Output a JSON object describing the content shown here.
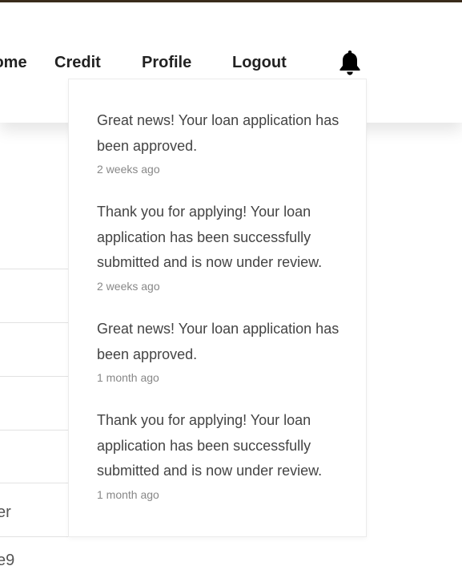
{
  "nav": {
    "items": [
      {
        "label": "Home"
      },
      {
        "label": "Credit"
      },
      {
        "label": "Profile"
      },
      {
        "label": "Logout"
      }
    ],
    "bell_icon": "bell-icon"
  },
  "notifications": [
    {
      "message": "Great news! Your loan application has been approved.",
      "time": "2 weeks ago"
    },
    {
      "message": "Thank you for applying! Your loan application has been successfully submitted and is now under review.",
      "time": "2 weeks ago"
    },
    {
      "message": "Great news! Your loan application has been approved.",
      "time": "1 month ago"
    },
    {
      "message": "Thank you for applying! Your loan application has been successfully submitted and is now under review.",
      "time": "1 month ago"
    }
  ],
  "background_rows": [
    {
      "text": ""
    },
    {
      "text": ""
    },
    {
      "text": ""
    },
    {
      "text": ""
    },
    {
      "text": "er"
    },
    {
      "text": "e9"
    }
  ],
  "colors": {
    "top_border": "#3b2c1c",
    "nav_text": "#222222",
    "notif_text": "#444444",
    "notif_time": "#888888"
  }
}
